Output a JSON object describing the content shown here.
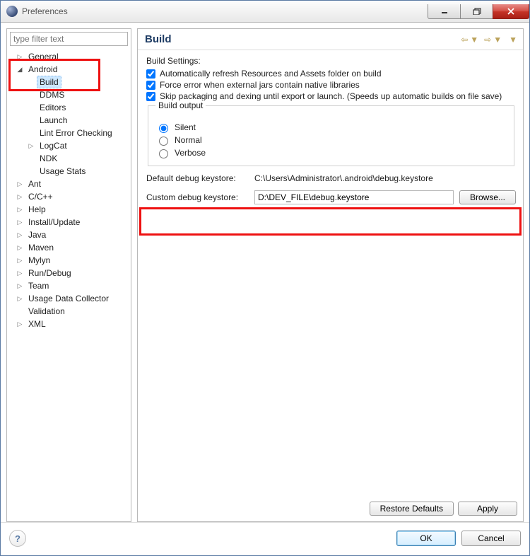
{
  "window": {
    "title": "Preferences"
  },
  "sidebar": {
    "filter_placeholder": "type filter text",
    "items": [
      {
        "depth": 1,
        "exp": "closed",
        "label": "General"
      },
      {
        "depth": 1,
        "exp": "open",
        "label": "Android"
      },
      {
        "depth": 2,
        "exp": "none",
        "label": "Build",
        "selected": true
      },
      {
        "depth": 2,
        "exp": "none",
        "label": "DDMS"
      },
      {
        "depth": 2,
        "exp": "none",
        "label": "Editors"
      },
      {
        "depth": 2,
        "exp": "none",
        "label": "Launch"
      },
      {
        "depth": 2,
        "exp": "none",
        "label": "Lint Error Checking"
      },
      {
        "depth": 2,
        "exp": "closed",
        "label": "LogCat"
      },
      {
        "depth": 2,
        "exp": "none",
        "label": "NDK"
      },
      {
        "depth": 2,
        "exp": "none",
        "label": "Usage Stats"
      },
      {
        "depth": 1,
        "exp": "closed",
        "label": "Ant"
      },
      {
        "depth": 1,
        "exp": "closed",
        "label": "C/C++"
      },
      {
        "depth": 1,
        "exp": "closed",
        "label": "Help"
      },
      {
        "depth": 1,
        "exp": "closed",
        "label": "Install/Update"
      },
      {
        "depth": 1,
        "exp": "closed",
        "label": "Java"
      },
      {
        "depth": 1,
        "exp": "closed",
        "label": "Maven"
      },
      {
        "depth": 1,
        "exp": "closed",
        "label": "Mylyn"
      },
      {
        "depth": 1,
        "exp": "closed",
        "label": "Run/Debug"
      },
      {
        "depth": 1,
        "exp": "closed",
        "label": "Team"
      },
      {
        "depth": 1,
        "exp": "closed",
        "label": "Usage Data Collector"
      },
      {
        "depth": 1,
        "exp": "none",
        "label": "Validation"
      },
      {
        "depth": 1,
        "exp": "closed",
        "label": "XML"
      }
    ]
  },
  "page": {
    "title": "Build",
    "settings_label": "Build Settings:",
    "checks": [
      "Automatically refresh Resources and Assets folder on build",
      "Force error when external jars contain native libraries",
      "Skip packaging and dexing until export or launch. (Speeds up automatic builds on file save)"
    ],
    "output_legend": "Build output",
    "output_options": [
      "Silent",
      "Normal",
      "Verbose"
    ],
    "output_selected": 0,
    "default_keystore_label": "Default debug keystore:",
    "default_keystore_value": "C:\\Users\\Administrator\\.android\\debug.keystore",
    "custom_keystore_label": "Custom debug keystore:",
    "custom_keystore_value": "D:\\DEV_FILE\\debug.keystore",
    "browse_label": "Browse...",
    "restore_label": "Restore Defaults",
    "apply_label": "Apply"
  },
  "footer": {
    "ok": "OK",
    "cancel": "Cancel"
  }
}
